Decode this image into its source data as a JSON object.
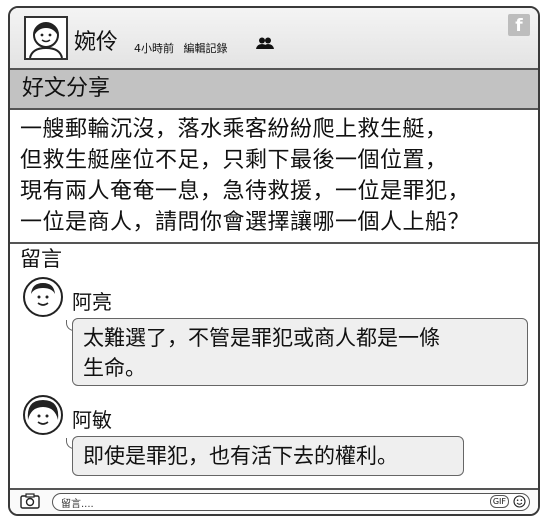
{
  "post": {
    "user": {
      "name": "婉伶",
      "time": "4小時前",
      "edit": "編輯記錄"
    },
    "header_icons": [
      "user-avatar-icon",
      "friends-icon",
      "facebook-icon"
    ],
    "title": "好文分享",
    "body_lines": [
      "一艘郵輪沉沒，落水乘客紛紛爬上救生艇，",
      "但救生艇座位不足，只剩下最後一個位置，",
      "現有兩人奄奄一息，急待救援，一位是罪犯，",
      "一位是商人，請問你會選擇讓哪一個人上船？"
    ]
  },
  "comments": {
    "title": "留言",
    "items": [
      {
        "name": "阿亮",
        "lines": [
          "太難選了，不管是罪犯或商人都是一條",
          "生命。"
        ]
      },
      {
        "name": "阿敏",
        "lines": [
          "即使是罪犯，也有活下去的權利。"
        ]
      }
    ]
  },
  "footer": {
    "placeholder": "留言....",
    "gif_label": "GIF",
    "icons": [
      "camera-icon",
      "gif-icon",
      "smiley-icon"
    ]
  }
}
